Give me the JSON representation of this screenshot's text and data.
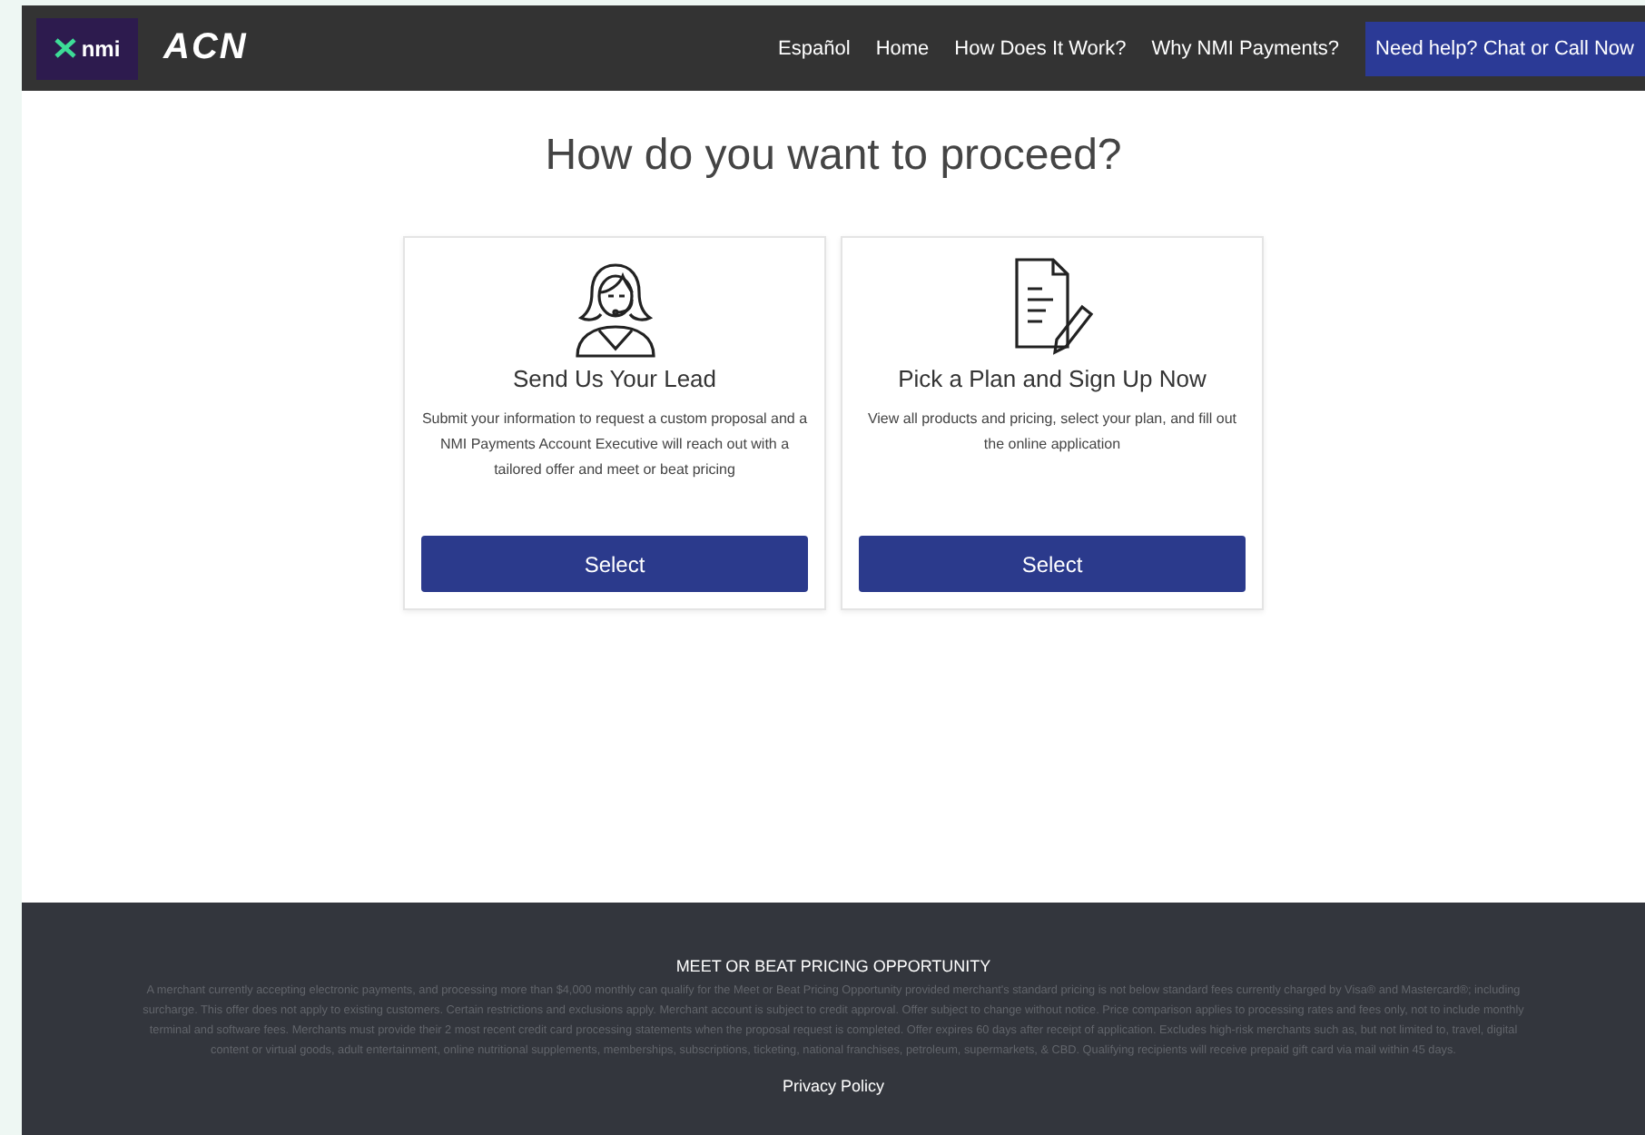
{
  "header": {
    "logos": [
      "nmi",
      "ACN"
    ],
    "nav": [
      {
        "label": "Español"
      },
      {
        "label": "Home"
      },
      {
        "label": "How Does It Work?"
      },
      {
        "label": "Why NMI Payments?"
      }
    ],
    "cta": "Need help? Chat or Call Now"
  },
  "heading": "How do you want to proceed?",
  "cards": [
    {
      "kind": "agent",
      "title": "Send Us Your Lead",
      "text": "Submit your information to request a custom proposal and a NMI Payments Account Executive will reach out with a tailored offer and meet or beat pricing",
      "button": "Select"
    },
    {
      "kind": "document",
      "title": "Pick a Plan and Sign Up Now",
      "text": "View all products and pricing, select your plan, and fill out the online application",
      "button": "Select"
    }
  ],
  "footer": {
    "title": "MEET OR BEAT PRICING OPPORTUNITY",
    "disclaimer": "A merchant currently accepting electronic payments, and processing more than $4,000 monthly can qualify for the Meet or Beat Pricing Opportunity provided merchant's standard pricing is not below standard fees currently charged by Visa® and Mastercard®; including surcharge. This offer does not apply to existing customers. Certain restrictions and exclusions apply. Merchant account is subject to credit approval. Offer subject to change without notice. Price comparison applies to processing rates and fees only, not to include monthly terminal and software fees. Merchants must provide their 2 most recent credit card processing statements when the proposal request is completed. Offer expires 60 days after receipt of application. Excludes high-risk merchants such as, but not limited to, travel, digital content or virtual goods, adult entertainment, online nutritional supplements, memberships, subscriptions, ticketing, national franchises, petroleum, supermarkets, & CBD. Qualifying recipients will receive prepaid gift card via mail within 45 days.",
    "link": "Privacy Policy"
  }
}
